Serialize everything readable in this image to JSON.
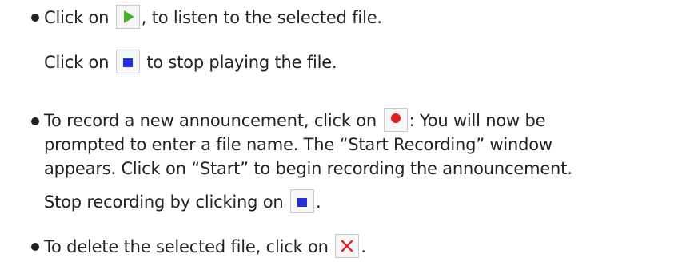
{
  "items": [
    {
      "play": {
        "before": "Click on",
        "icon": "play-icon",
        "after": ", to listen to the selected file."
      },
      "stop": {
        "before": "Click on",
        "icon": "stop-icon",
        "after": "to stop playing the file."
      }
    },
    {
      "record": {
        "before": "To record a new announcement, click on",
        "icon": "record-icon",
        "after": ": You will now be",
        "line2": "prompted to enter a file name. The “Start Recording” window",
        "line3": "appears. Click on “Start” to begin recording the announcement."
      },
      "stop": {
        "before": "Stop recording by clicking on",
        "icon": "stop-icon",
        "after": "."
      }
    },
    {
      "delete": {
        "before": "To delete the selected file, click on",
        "icon": "delete-icon",
        "after": "."
      }
    }
  ],
  "colors": {
    "text": "#222222",
    "play": "#4caf2a",
    "stop": "#1f2fe0",
    "record": "#e21b1b",
    "delete": "#e02a2a",
    "button_border": "#c9c9c9",
    "button_bg": "#f6f6f6"
  }
}
